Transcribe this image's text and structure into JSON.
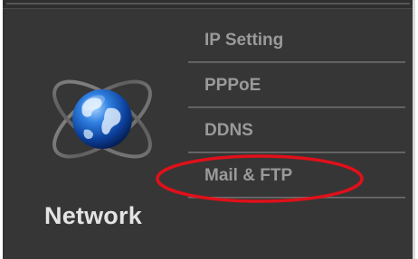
{
  "section": {
    "title": "Network",
    "icon": "globe-orbit-icon"
  },
  "menu": {
    "items": [
      {
        "label": "IP Setting"
      },
      {
        "label": "PPPoE"
      },
      {
        "label": "DDNS"
      },
      {
        "label": "Mail & FTP"
      }
    ],
    "highlighted_item": "Mail & FTP",
    "highlight_color": "#e0101a"
  },
  "colors": {
    "panel_background": "#363636",
    "menu_text": "#9a9a9a",
    "title_text": "#e4e4e4"
  }
}
